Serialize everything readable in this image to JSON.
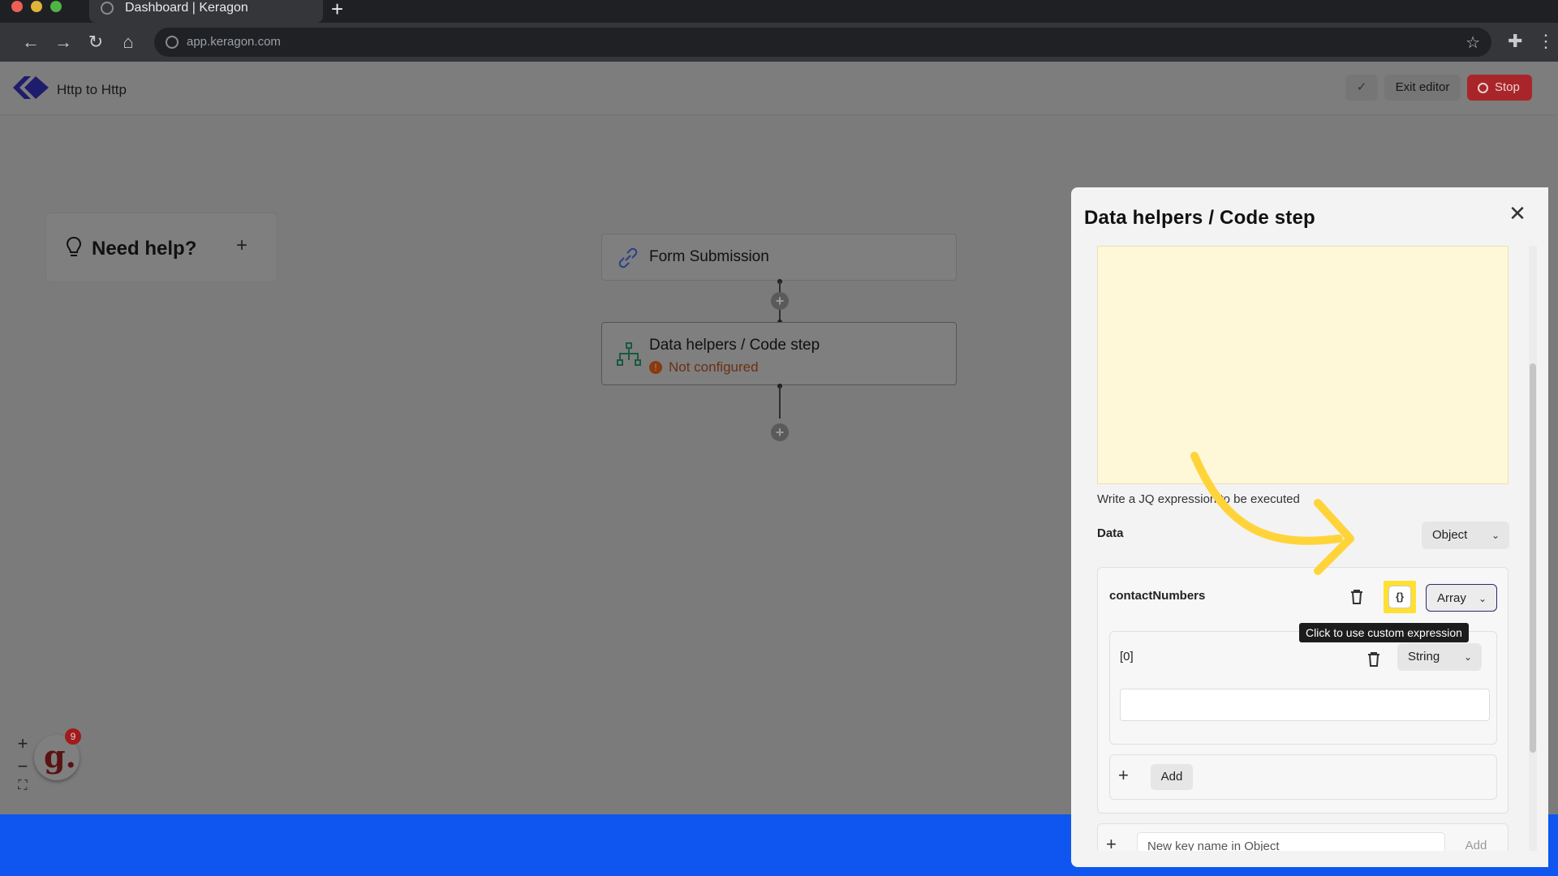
{
  "browser": {
    "tab_title": "Dashboard | Keragon",
    "url": "app.keragon.com"
  },
  "header": {
    "workflow_name": "Http to Http",
    "exit_label": "Exit editor",
    "stop_label": "Stop"
  },
  "canvas": {
    "help_label": "Need help?",
    "nodes": [
      {
        "title": "Form Submission",
        "status": ""
      },
      {
        "title": "Data helpers / Code step",
        "status": "Not configured"
      }
    ],
    "notification_count": "9"
  },
  "panel": {
    "title": "Data helpers / Code step",
    "helper_text": "Write a JQ expression to be executed",
    "data_label": "Data",
    "data_type": "Object",
    "field_name": "contactNumbers",
    "field_type": "Array",
    "tooltip": "Click to use custom expression",
    "custom_expr_glyph": "{}",
    "item_label": "[0]",
    "item_type": "String",
    "item_value": "",
    "add_label": "Add",
    "new_key_placeholder": "New key name in Object",
    "new_key_add": "Add"
  },
  "colors": {
    "accent_blue": "#0f56f0",
    "stop_red": "#a8262a",
    "highlight_yellow": "#ffe033",
    "editor_bg": "#fff8d8"
  }
}
